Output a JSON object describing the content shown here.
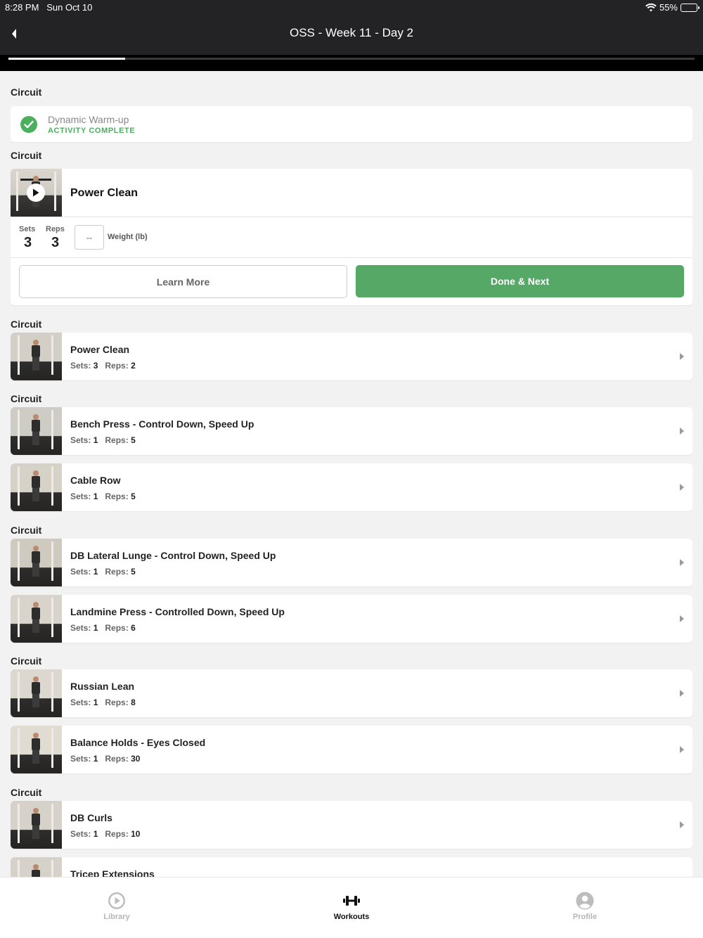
{
  "status_bar": {
    "time": "8:28 PM",
    "date": "Sun Oct 10",
    "battery": "55%",
    "battery_level": 0.55
  },
  "header": {
    "title": "OSS - Week 11 - Day 2",
    "progress": 0.17
  },
  "circuit_label": "Circuit",
  "completed": {
    "name": "Dynamic Warm-up",
    "status": "ACTIVITY COMPLETE"
  },
  "active": {
    "name": "Power Clean",
    "sets_label": "Sets",
    "reps_label": "Reps",
    "sets": "3",
    "reps": "3",
    "weight_value": "--",
    "weight_label": "Weight (lb)",
    "learn_more": "Learn More",
    "done_next": "Done & Next"
  },
  "meta_labels": {
    "sets": "Sets:",
    "reps": "Reps:"
  },
  "exercises": [
    {
      "name": "Power Clean",
      "sets": "3",
      "reps": "2"
    },
    {
      "name": "Bench Press - Control Down, Speed Up",
      "sets": "1",
      "reps": "5"
    },
    {
      "name": "Cable Row",
      "sets": "1",
      "reps": "5"
    },
    {
      "name": "DB Lateral Lunge - Control Down, Speed Up",
      "sets": "1",
      "reps": "5"
    },
    {
      "name": "Landmine Press - Controlled Down, Speed Up",
      "sets": "1",
      "reps": "6"
    },
    {
      "name": "Russian Lean",
      "sets": "1",
      "reps": "8"
    },
    {
      "name": "Balance Holds - Eyes Closed",
      "sets": "1",
      "reps": "30"
    },
    {
      "name": "DB Curls",
      "sets": "1",
      "reps": "10"
    },
    {
      "name": "Tricep Extensions"
    }
  ],
  "tabs": [
    {
      "label": "Library",
      "icon": "play-circle-icon",
      "active": false
    },
    {
      "label": "Workouts",
      "icon": "dumbbell-icon",
      "active": true
    },
    {
      "label": "Profile",
      "icon": "profile-icon",
      "active": false
    }
  ],
  "colors": {
    "accent_green": "#55a865",
    "header_bg": "#232325",
    "inactive_tab": "#b5b5b5"
  }
}
